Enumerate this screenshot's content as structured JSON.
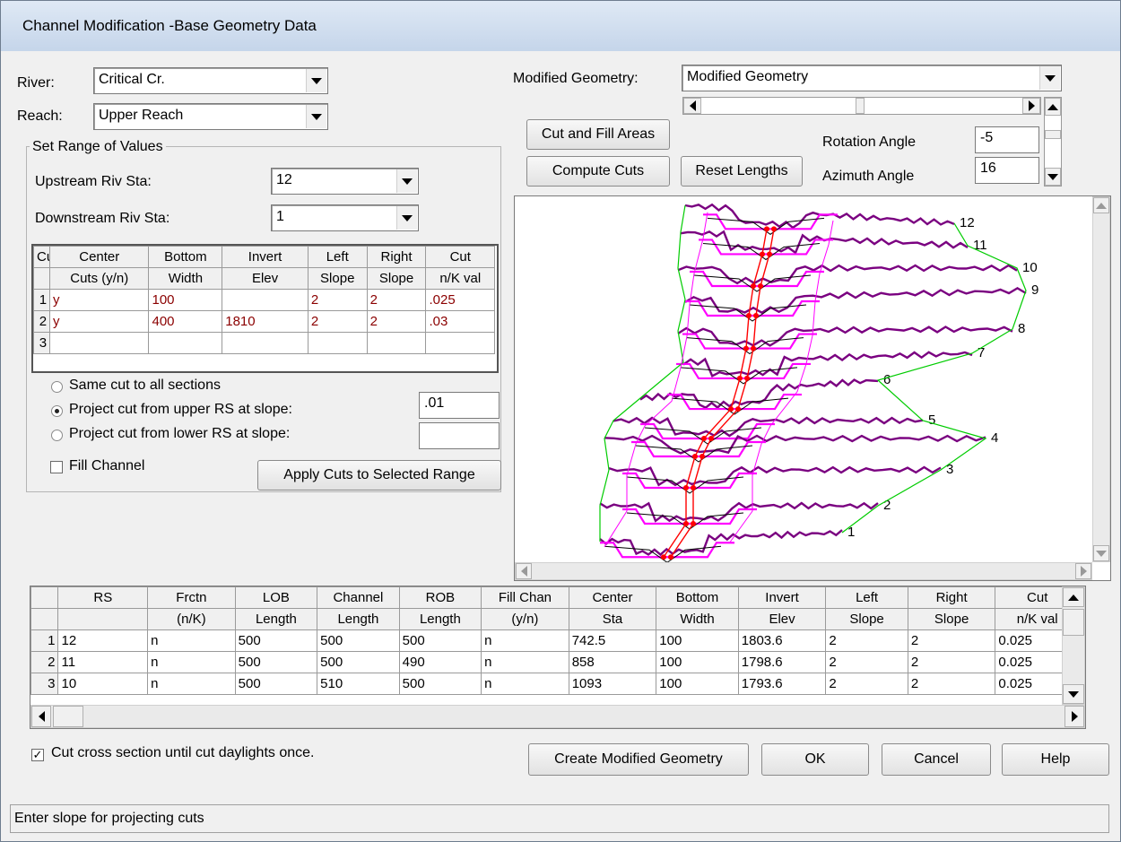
{
  "window": {
    "title": "Channel Modification -Base Geometry Data"
  },
  "river": {
    "label": "River:",
    "value": "Critical Cr."
  },
  "reach": {
    "label": "Reach:",
    "value": "Upper Reach"
  },
  "range_group": {
    "title": "Set Range of Values",
    "upstream_label": "Upstream Riv Sta:",
    "upstream_value": "12",
    "downstream_label": "Downstream Riv Sta:",
    "downstream_value": "1"
  },
  "cut_table": {
    "headers_top": [
      "Cut",
      "Center",
      "Bottom",
      "Invert",
      "Left",
      "Right",
      "Cut"
    ],
    "headers_bottom": [
      "",
      "Cuts (y/n)",
      "Width",
      "Elev",
      "Slope",
      "Slope",
      "n/K val"
    ],
    "rows": [
      [
        "1",
        "y",
        "100",
        "",
        "2",
        "2",
        ".025"
      ],
      [
        "2",
        "y",
        "400",
        "1810",
        "2",
        "2",
        ".03"
      ],
      [
        "3",
        "",
        "",
        "",
        "",
        "",
        ""
      ]
    ]
  },
  "options": {
    "same_cut": "Same cut to all sections",
    "project_upper": "Project cut from upper RS at slope:",
    "project_upper_value": ".01",
    "project_lower": "Project cut from lower RS at slope:",
    "project_lower_value": "",
    "selected": "project_upper",
    "fill_channel": "Fill Channel",
    "fill_channel_checked": false,
    "apply_button": "Apply Cuts to Selected Range"
  },
  "modified_geometry": {
    "label": "Modified Geometry:",
    "value": "Modified Geometry"
  },
  "buttons": {
    "cut_fill": "Cut and Fill Areas",
    "compute_cuts": "Compute Cuts",
    "reset_lengths": "Reset Lengths",
    "create_modified": "Create Modified Geometry",
    "ok": "OK",
    "cancel": "Cancel",
    "help": "Help"
  },
  "angles": {
    "rotation_label": "Rotation Angle",
    "rotation_value": "-5",
    "azimuth_label": "Azimuth Angle",
    "azimuth_value": "16"
  },
  "plot": {
    "station_labels": [
      "12",
      "11",
      "10",
      "9",
      "8",
      "7",
      "6",
      "5",
      "4",
      "3",
      "2",
      "1"
    ],
    "colors": {
      "existing": "#7a0080",
      "cut": "#ff00ff",
      "bank": "#00cc00",
      "centerline": "#ff0000"
    }
  },
  "main_table": {
    "headers_top": [
      "",
      "RS",
      "Frctn",
      "LOB",
      "Channel",
      "ROB",
      "Fill Chan",
      "Center",
      "Bottom",
      "Invert",
      "Left",
      "Right",
      "Cut"
    ],
    "headers_bottom": [
      "",
      "",
      "(n/K)",
      "Length",
      "Length",
      "Length",
      "(y/n)",
      "Sta",
      "Width",
      "Elev",
      "Slope",
      "Slope",
      "n/K val"
    ],
    "rows": [
      [
        "1",
        "12",
        "n",
        "500",
        "500",
        "500",
        "n",
        "742.5",
        "100",
        "1803.6",
        "2",
        "2",
        "0.025"
      ],
      [
        "2",
        "11",
        "n",
        "500",
        "500",
        "490",
        "n",
        "858",
        "100",
        "1798.6",
        "2",
        "2",
        "0.025"
      ],
      [
        "3",
        "10",
        "n",
        "500",
        "510",
        "500",
        "n",
        "1093",
        "100",
        "1793.6",
        "2",
        "2",
        "0.025"
      ]
    ]
  },
  "daylight": {
    "label": "Cut cross section until cut daylights once.",
    "checked": true
  },
  "status": {
    "text": "Enter slope for projecting cuts"
  }
}
